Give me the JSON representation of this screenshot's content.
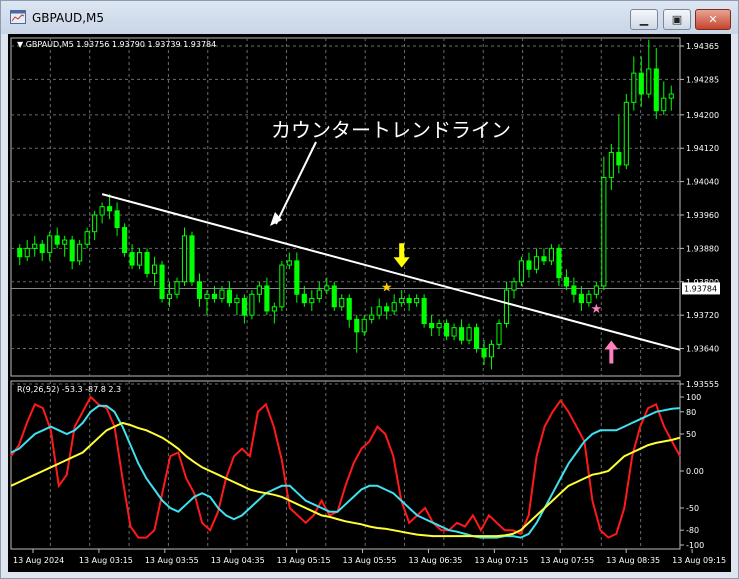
{
  "window": {
    "title": "GBPAUD,M5"
  },
  "chart": {
    "info_line": "GBPAUD,M5  1.93756 1.93790 1.93739 1.93784",
    "price_ticks": [
      "1.94365",
      "1.94285",
      "1.94200",
      "1.94120",
      "1.94040",
      "1.93960",
      "1.93880",
      "1.93800",
      "1.93720",
      "1.93640",
      "1.93555"
    ],
    "current_price": "1.93784",
    "annotation": "カウンタートレンドライン",
    "indicator_label": "R(9,26,52) -53.3 -87.8 2.3",
    "indicator_ticks": [
      "100",
      "80",
      "50",
      "0.00",
      "-50",
      "-80",
      "-100"
    ],
    "time_labels": [
      "13 Aug 2024",
      "13 Aug 03:15",
      "13 Aug 03:55",
      "13 Aug 04:35",
      "13 Aug 05:15",
      "13 Aug 05:55",
      "13 Aug 06:35",
      "13 Aug 07:15",
      "13 Aug 07:55",
      "13 Aug 08:35",
      "13 Aug 09:15"
    ],
    "colors": {
      "bull": "#00ff00",
      "bear": "#00ff00",
      "grid": "#6b6b6b",
      "red": "#ff1a1a",
      "cyan": "#3fe0f0",
      "yellow": "#ffff33",
      "arrow_down": "#ffff00",
      "arrow_up": "#ff7fbf"
    }
  },
  "chart_data": {
    "type": "candlestick",
    "candles": [
      [
        1.9388,
        1.9389,
        1.9384,
        1.9386
      ],
      [
        1.9386,
        1.939,
        1.9385,
        1.9388
      ],
      [
        1.9388,
        1.9391,
        1.9386,
        1.9389
      ],
      [
        1.9389,
        1.939,
        1.9385,
        1.9387
      ],
      [
        1.9387,
        1.9392,
        1.9385,
        1.9391
      ],
      [
        1.9391,
        1.9393,
        1.9388,
        1.9389
      ],
      [
        1.9389,
        1.9391,
        1.9386,
        1.939
      ],
      [
        1.939,
        1.9391,
        1.9383,
        1.9385
      ],
      [
        1.9385,
        1.939,
        1.9384,
        1.9389
      ],
      [
        1.9389,
        1.9393,
        1.9388,
        1.9392
      ],
      [
        1.9392,
        1.9397,
        1.939,
        1.9396
      ],
      [
        1.9396,
        1.9399,
        1.9394,
        1.9398
      ],
      [
        1.9398,
        1.9401,
        1.9395,
        1.9397
      ],
      [
        1.9397,
        1.9399,
        1.9391,
        1.9393
      ],
      [
        1.9393,
        1.9394,
        1.9386,
        1.9387
      ],
      [
        1.9387,
        1.9389,
        1.9383,
        1.9384
      ],
      [
        1.9384,
        1.9388,
        1.9383,
        1.9387
      ],
      [
        1.9387,
        1.9388,
        1.9381,
        1.9382
      ],
      [
        1.9382,
        1.9386,
        1.9379,
        1.9384
      ],
      [
        1.9384,
        1.9385,
        1.9375,
        1.9376
      ],
      [
        1.9376,
        1.938,
        1.9374,
        1.9377
      ],
      [
        1.9377,
        1.9381,
        1.9376,
        1.938
      ],
      [
        1.938,
        1.9393,
        1.9379,
        1.9391
      ],
      [
        1.9391,
        1.9392,
        1.9379,
        1.938
      ],
      [
        1.938,
        1.9382,
        1.9374,
        1.9376
      ],
      [
        1.9376,
        1.9378,
        1.9372,
        1.9377
      ],
      [
        1.9377,
        1.9379,
        1.9375,
        1.9376
      ],
      [
        1.9376,
        1.9379,
        1.9375,
        1.9378
      ],
      [
        1.9378,
        1.938,
        1.9374,
        1.9375
      ],
      [
        1.9375,
        1.9377,
        1.9372,
        1.9376
      ],
      [
        1.9376,
        1.9377,
        1.937,
        1.9372
      ],
      [
        1.9372,
        1.9378,
        1.9371,
        1.9377
      ],
      [
        1.9377,
        1.938,
        1.9375,
        1.9379
      ],
      [
        1.9379,
        1.9381,
        1.9372,
        1.9373
      ],
      [
        1.9373,
        1.9375,
        1.937,
        1.9374
      ],
      [
        1.9374,
        1.9385,
        1.9373,
        1.9384
      ],
      [
        1.9384,
        1.9387,
        1.9383,
        1.9385
      ],
      [
        1.9385,
        1.9387,
        1.9375,
        1.9377
      ],
      [
        1.9377,
        1.9379,
        1.9374,
        1.9375
      ],
      [
        1.9375,
        1.9378,
        1.9373,
        1.9376
      ],
      [
        1.9376,
        1.938,
        1.9375,
        1.9378
      ],
      [
        1.9378,
        1.9381,
        1.9377,
        1.9379
      ],
      [
        1.9379,
        1.938,
        1.9373,
        1.9374
      ],
      [
        1.9374,
        1.9377,
        1.9373,
        1.9376
      ],
      [
        1.9376,
        1.9377,
        1.9369,
        1.9371
      ],
      [
        1.9371,
        1.9372,
        1.9363,
        1.9368
      ],
      [
        1.9368,
        1.9372,
        1.9367,
        1.9371
      ],
      [
        1.9371,
        1.9374,
        1.937,
        1.9372
      ],
      [
        1.9372,
        1.9376,
        1.9371,
        1.9374
      ],
      [
        1.9374,
        1.9375,
        1.9371,
        1.9373
      ],
      [
        1.9373,
        1.9377,
        1.9372,
        1.9375
      ],
      [
        1.9375,
        1.9378,
        1.9374,
        1.9376
      ],
      [
        1.9376,
        1.9377,
        1.9373,
        1.9375
      ],
      [
        1.9375,
        1.9377,
        1.9374,
        1.9376
      ],
      [
        1.9376,
        1.9377,
        1.9369,
        1.937
      ],
      [
        1.937,
        1.9372,
        1.9367,
        1.9369
      ],
      [
        1.9369,
        1.9371,
        1.9367,
        1.937
      ],
      [
        1.937,
        1.9371,
        1.9366,
        1.9367
      ],
      [
        1.9367,
        1.937,
        1.9366,
        1.9369
      ],
      [
        1.9369,
        1.9371,
        1.9365,
        1.9366
      ],
      [
        1.9366,
        1.937,
        1.9365,
        1.9369
      ],
      [
        1.9369,
        1.937,
        1.9363,
        1.9364
      ],
      [
        1.9364,
        1.9366,
        1.936,
        1.9362
      ],
      [
        1.9362,
        1.9366,
        1.9359,
        1.9365
      ],
      [
        1.9365,
        1.9371,
        1.9364,
        1.937
      ],
      [
        1.937,
        1.938,
        1.9369,
        1.9378
      ],
      [
        1.9378,
        1.9381,
        1.9376,
        1.938
      ],
      [
        1.938,
        1.9386,
        1.9379,
        1.9385
      ],
      [
        1.9385,
        1.9387,
        1.9381,
        1.9383
      ],
      [
        1.9383,
        1.9388,
        1.9382,
        1.9386
      ],
      [
        1.9386,
        1.9388,
        1.9384,
        1.9385
      ],
      [
        1.9385,
        1.9389,
        1.9384,
        1.9388
      ],
      [
        1.9388,
        1.9389,
        1.9379,
        1.9381
      ],
      [
        1.9381,
        1.9383,
        1.9378,
        1.9379
      ],
      [
        1.9379,
        1.9381,
        1.9375,
        1.9377
      ],
      [
        1.9377,
        1.9379,
        1.9373,
        1.9375
      ],
      [
        1.9375,
        1.9378,
        1.9374,
        1.9377
      ],
      [
        1.9377,
        1.938,
        1.9376,
        1.9379
      ],
      [
        1.9379,
        1.941,
        1.9378,
        1.9405
      ],
      [
        1.9405,
        1.9413,
        1.9402,
        1.9411
      ],
      [
        1.9411,
        1.942,
        1.9406,
        1.9408
      ],
      [
        1.9408,
        1.9425,
        1.9407,
        1.9423
      ],
      [
        1.9423,
        1.9434,
        1.9421,
        1.943
      ],
      [
        1.943,
        1.9434,
        1.9422,
        1.9425
      ],
      [
        1.9425,
        1.9438,
        1.9424,
        1.9431
      ],
      [
        1.9431,
        1.9436,
        1.9419,
        1.9421
      ],
      [
        1.9421,
        1.9428,
        1.942,
        1.9424
      ],
      [
        1.9424,
        1.9427,
        1.9421,
        1.9425
      ]
    ],
    "trendline": {
      "start_index": 11,
      "start_price": 1.9401,
      "end_price": 1.93637
    },
    "markers": [
      {
        "type": "star",
        "index": 49,
        "price": 1.93786,
        "color": "#ffcc00"
      },
      {
        "type": "star",
        "index": 77,
        "price": 1.93735,
        "color": "#ff7fbf"
      }
    ],
    "indicator": {
      "ylim": [
        -100,
        100
      ],
      "series": [
        {
          "color": "#ff1a1a",
          "values": [
            20,
            35,
            65,
            90,
            85,
            55,
            -20,
            -5,
            60,
            80,
            100,
            90,
            85,
            60,
            -10,
            -75,
            -90,
            -90,
            -80,
            -30,
            20,
            25,
            -10,
            -30,
            -70,
            -80,
            -55,
            -10,
            20,
            30,
            20,
            80,
            90,
            60,
            15,
            -50,
            -60,
            -70,
            -60,
            -40,
            -60,
            -55,
            -20,
            10,
            30,
            40,
            60,
            50,
            20,
            -40,
            -70,
            -60,
            -50,
            -70,
            -80,
            -80,
            -70,
            -75,
            -60,
            -80,
            -60,
            -70,
            -80,
            -80,
            -85,
            -60,
            20,
            60,
            80,
            95,
            80,
            60,
            40,
            -40,
            -80,
            -90,
            -85,
            -50,
            20,
            60,
            85,
            90,
            60,
            40,
            20
          ]
        },
        {
          "color": "#3fe0f0",
          "values": [
            25,
            30,
            40,
            50,
            55,
            60,
            55,
            50,
            55,
            65,
            80,
            88,
            88,
            80,
            60,
            35,
            10,
            -10,
            -25,
            -40,
            -50,
            -55,
            -45,
            -35,
            -30,
            -35,
            -50,
            -60,
            -65,
            -60,
            -50,
            -40,
            -30,
            -25,
            -20,
            -20,
            -30,
            -40,
            -45,
            -50,
            -55,
            -55,
            -45,
            -35,
            -25,
            -20,
            -20,
            -25,
            -30,
            -40,
            -50,
            -60,
            -65,
            -70,
            -75,
            -80,
            -82,
            -85,
            -88,
            -90,
            -90,
            -90,
            -88,
            -88,
            -90,
            -85,
            -70,
            -50,
            -30,
            -10,
            10,
            25,
            40,
            50,
            55,
            55,
            55,
            60,
            65,
            70,
            75,
            80,
            82,
            84,
            85
          ]
        },
        {
          "color": "#ffff33",
          "values": [
            -20,
            -15,
            -10,
            -5,
            0,
            5,
            10,
            15,
            20,
            25,
            35,
            45,
            55,
            60,
            65,
            62,
            58,
            55,
            50,
            45,
            38,
            30,
            20,
            12,
            5,
            0,
            -5,
            -10,
            -15,
            -20,
            -25,
            -28,
            -30,
            -32,
            -35,
            -40,
            -45,
            -50,
            -55,
            -60,
            -62,
            -65,
            -68,
            -70,
            -72,
            -75,
            -77,
            -78,
            -80,
            -82,
            -84,
            -86,
            -87,
            -88,
            -88,
            -88,
            -88,
            -88,
            -88,
            -88,
            -88,
            -88,
            -87,
            -85,
            -80,
            -70,
            -60,
            -50,
            -40,
            -30,
            -20,
            -15,
            -10,
            -5,
            -3,
            0,
            10,
            20,
            25,
            30,
            35,
            38,
            40,
            42,
            45
          ]
        }
      ]
    }
  }
}
